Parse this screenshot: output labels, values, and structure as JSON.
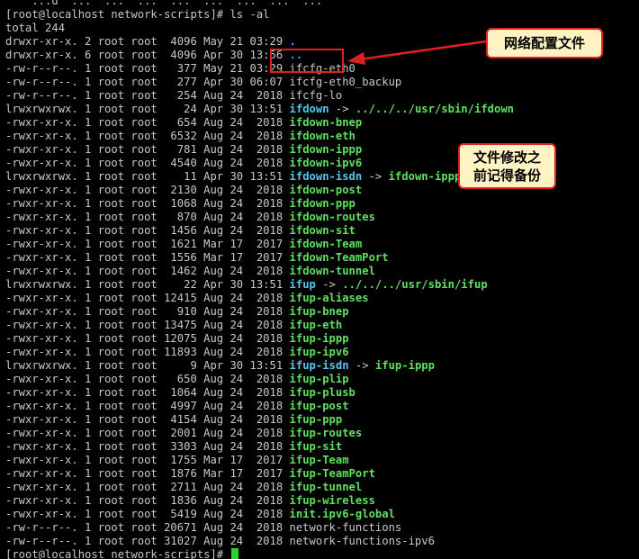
{
  "terminal": {
    "lines": [
      [
        {
          "t": "    ...d  ...  ...  ...  ...  ...  ...  ...  ...",
          "c": "default"
        }
      ],
      [
        {
          "t": "[root@localhost network-scripts]# ls -al",
          "c": "default"
        }
      ],
      [
        {
          "t": "total 244",
          "c": "default"
        }
      ],
      [
        {
          "t": "drwxr-xr-x. 2 root root  4096 May 21 03:29 ",
          "c": "default"
        },
        {
          "t": ".",
          "c": "blue"
        }
      ],
      [
        {
          "t": "drwxr-xr-x. 6 root root  4096 Apr 30 13:56 ",
          "c": "default"
        },
        {
          "t": "..",
          "c": "blue"
        }
      ],
      [
        {
          "t": "-rw-r--r--. 1 root root   377 May 21 03:29 ifcfg-eth0",
          "c": "default"
        }
      ],
      [
        {
          "t": "-rw-r--r--. 1 root root   277 Apr 30 06:07 ifcfg-eth0_backup",
          "c": "default"
        }
      ],
      [
        {
          "t": "-rw-r--r--. 1 root root   254 Aug 24  2018 ifcfg-lo",
          "c": "default"
        }
      ],
      [
        {
          "t": "lrwxrwxrwx. 1 root root    24 Apr 30 13:51 ",
          "c": "default"
        },
        {
          "t": "ifdown",
          "c": "cyan"
        },
        {
          "t": " -> ",
          "c": "default"
        },
        {
          "t": "../../../usr/sbin/ifdown",
          "c": "green"
        }
      ],
      [
        {
          "t": "-rwxr-xr-x. 1 root root   654 Aug 24  2018 ",
          "c": "default"
        },
        {
          "t": "ifdown-bnep",
          "c": "green"
        }
      ],
      [
        {
          "t": "-rwxr-xr-x. 1 root root  6532 Aug 24  2018 ",
          "c": "default"
        },
        {
          "t": "ifdown-eth",
          "c": "green"
        }
      ],
      [
        {
          "t": "-rwxr-xr-x. 1 root root   781 Aug 24  2018 ",
          "c": "default"
        },
        {
          "t": "ifdown-ippp",
          "c": "green"
        }
      ],
      [
        {
          "t": "-rwxr-xr-x. 1 root root  4540 Aug 24  2018 ",
          "c": "default"
        },
        {
          "t": "ifdown-ipv6",
          "c": "green"
        }
      ],
      [
        {
          "t": "lrwxrwxrwx. 1 root root    11 Apr 30 13:51 ",
          "c": "default"
        },
        {
          "t": "ifdown-isdn",
          "c": "cyan"
        },
        {
          "t": " -> ",
          "c": "default"
        },
        {
          "t": "ifdown-ippp",
          "c": "green"
        }
      ],
      [
        {
          "t": "-rwxr-xr-x. 1 root root  2130 Aug 24  2018 ",
          "c": "default"
        },
        {
          "t": "ifdown-post",
          "c": "green"
        }
      ],
      [
        {
          "t": "-rwxr-xr-x. 1 root root  1068 Aug 24  2018 ",
          "c": "default"
        },
        {
          "t": "ifdown-ppp",
          "c": "green"
        }
      ],
      [
        {
          "t": "-rwxr-xr-x. 1 root root   870 Aug 24  2018 ",
          "c": "default"
        },
        {
          "t": "ifdown-routes",
          "c": "green"
        }
      ],
      [
        {
          "t": "-rwxr-xr-x. 1 root root  1456 Aug 24  2018 ",
          "c": "default"
        },
        {
          "t": "ifdown-sit",
          "c": "green"
        }
      ],
      [
        {
          "t": "-rwxr-xr-x. 1 root root  1621 Mar 17  2017 ",
          "c": "default"
        },
        {
          "t": "ifdown-Team",
          "c": "green"
        }
      ],
      [
        {
          "t": "-rwxr-xr-x. 1 root root  1556 Mar 17  2017 ",
          "c": "default"
        },
        {
          "t": "ifdown-TeamPort",
          "c": "green"
        }
      ],
      [
        {
          "t": "-rwxr-xr-x. 1 root root  1462 Aug 24  2018 ",
          "c": "default"
        },
        {
          "t": "ifdown-tunnel",
          "c": "green"
        }
      ],
      [
        {
          "t": "lrwxrwxrwx. 1 root root    22 Apr 30 13:51 ",
          "c": "default"
        },
        {
          "t": "ifup",
          "c": "cyan"
        },
        {
          "t": " -> ",
          "c": "default"
        },
        {
          "t": "../../../usr/sbin/ifup",
          "c": "green"
        }
      ],
      [
        {
          "t": "-rwxr-xr-x. 1 root root 12415 Aug 24  2018 ",
          "c": "default"
        },
        {
          "t": "ifup-aliases",
          "c": "green"
        }
      ],
      [
        {
          "t": "-rwxr-xr-x. 1 root root   910 Aug 24  2018 ",
          "c": "default"
        },
        {
          "t": "ifup-bnep",
          "c": "green"
        }
      ],
      [
        {
          "t": "-rwxr-xr-x. 1 root root 13475 Aug 24  2018 ",
          "c": "default"
        },
        {
          "t": "ifup-eth",
          "c": "green"
        }
      ],
      [
        {
          "t": "-rwxr-xr-x. 1 root root 12075 Aug 24  2018 ",
          "c": "default"
        },
        {
          "t": "ifup-ippp",
          "c": "green"
        }
      ],
      [
        {
          "t": "-rwxr-xr-x. 1 root root 11893 Aug 24  2018 ",
          "c": "default"
        },
        {
          "t": "ifup-ipv6",
          "c": "green"
        }
      ],
      [
        {
          "t": "lrwxrwxrwx. 1 root root     9 Apr 30 13:51 ",
          "c": "default"
        },
        {
          "t": "ifup-isdn",
          "c": "cyan"
        },
        {
          "t": " -> ",
          "c": "default"
        },
        {
          "t": "ifup-ippp",
          "c": "green"
        }
      ],
      [
        {
          "t": "-rwxr-xr-x. 1 root root   650 Aug 24  2018 ",
          "c": "default"
        },
        {
          "t": "ifup-plip",
          "c": "green"
        }
      ],
      [
        {
          "t": "-rwxr-xr-x. 1 root root  1064 Aug 24  2018 ",
          "c": "default"
        },
        {
          "t": "ifup-plusb",
          "c": "green"
        }
      ],
      [
        {
          "t": "-rwxr-xr-x. 1 root root  4997 Aug 24  2018 ",
          "c": "default"
        },
        {
          "t": "ifup-post",
          "c": "green"
        }
      ],
      [
        {
          "t": "-rwxr-xr-x. 1 root root  4154 Aug 24  2018 ",
          "c": "default"
        },
        {
          "t": "ifup-ppp",
          "c": "green"
        }
      ],
      [
        {
          "t": "-rwxr-xr-x. 1 root root  2001 Aug 24  2018 ",
          "c": "default"
        },
        {
          "t": "ifup-routes",
          "c": "green"
        }
      ],
      [
        {
          "t": "-rwxr-xr-x. 1 root root  3303 Aug 24  2018 ",
          "c": "default"
        },
        {
          "t": "ifup-sit",
          "c": "green"
        }
      ],
      [
        {
          "t": "-rwxr-xr-x. 1 root root  1755 Mar 17  2017 ",
          "c": "default"
        },
        {
          "t": "ifup-Team",
          "c": "green"
        }
      ],
      [
        {
          "t": "-rwxr-xr-x. 1 root root  1876 Mar 17  2017 ",
          "c": "default"
        },
        {
          "t": "ifup-TeamPort",
          "c": "green"
        }
      ],
      [
        {
          "t": "-rwxr-xr-x. 1 root root  2711 Aug 24  2018 ",
          "c": "default"
        },
        {
          "t": "ifup-tunnel",
          "c": "green"
        }
      ],
      [
        {
          "t": "-rwxr-xr-x. 1 root root  1836 Aug 24  2018 ",
          "c": "default"
        },
        {
          "t": "ifup-wireless",
          "c": "green"
        }
      ],
      [
        {
          "t": "-rwxr-xr-x. 1 root root  5419 Aug 24  2018 ",
          "c": "default"
        },
        {
          "t": "init.ipv6-global",
          "c": "green"
        }
      ],
      [
        {
          "t": "-rw-r--r--. 1 root root 20671 Aug 24  2018 network-functions",
          "c": "default"
        }
      ],
      [
        {
          "t": "-rw-r--r--. 1 root root 31027 Aug 24  2018 network-functions-ipv6",
          "c": "default"
        }
      ],
      [
        {
          "t": "[root@localhost network-scripts]# ",
          "c": "default"
        }
      ]
    ]
  },
  "annotations": {
    "callout_1": "网络配置文件",
    "callout_2_line1": "文件修改之",
    "callout_2_line2": "前记得备份"
  },
  "colors": {
    "background": "#000000",
    "text": "#c8c8c8",
    "executable": "#5fe05f",
    "symlink": "#55c8f0",
    "directory": "#5c8cff",
    "cursor": "#2ad42a",
    "annotation_border": "#e02020",
    "callout_fill": "#fff3c4"
  },
  "icons": {
    "cursor": "block-cursor",
    "pointer": "red-arrow-icon"
  }
}
